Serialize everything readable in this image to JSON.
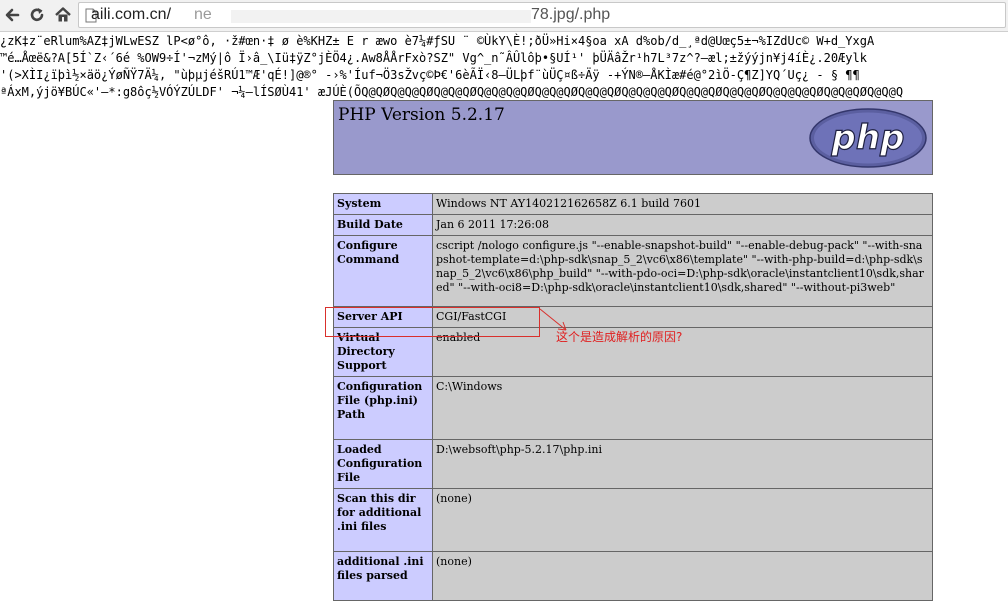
{
  "browser": {
    "back_icon": "back-arrow-icon",
    "reload_icon": "reload-icon",
    "home_icon": "home-icon",
    "url_host": "aili.com.cn/",
    "url_faded": "ne",
    "url_tail": "78.jpg/.php"
  },
  "garbage": [
    "¿zK‡z¨eRlum%AZ‡jWLwESZ lP<ø°ô, ·ž#œn·‡ ø è%KHZ± E r æwo è7¼#ƒSU ¨ ©ÙkY\\È!;ðÜ»Hi×4§oa xA d%ob/d_¸ªd@Uœç5±¬%IZdUc© W+d_YxgA",
    "™é…Åœë&?A[5Í`Z‹´6é %OW9÷Í'¬zMý|ô Ï›â_\\Iü‡ÿZ°jÈÖ4¿.Aw8ÅÅrFxò?SZ\" Vg^_n˜ÂÛlôþ•§UÍ¹' þÜÄâŽr¹h7L³7z^?—æl;±žýýjn¥j4íÈ¿.20Æylk",
    "'(>XÌI¿ïþì½×äö¿ÝøÑŸ7Ä¼, \"ùþµjéšRÚ1™Æ'qÉ!]@®° -›%'Íuf¬Ö3sŽvç©Þ€'6èÃÏ‹8—ÜLþf¨ùÜÇ¤ß÷Äÿ -+ÝN®—ÅKÌæ#é@°2ìÖ-Ç¶Z]YQ´Uç¿ - § ¶¶",
    "ªÁxM,ýjö¥BÚC«'—*:g8ôç½VÓÝZÚLDF' ¬¼—lÍSØÙ41' æJÚÈ(ÕQ@QØQ@Q@QØQ@Q@QØQ@Q@Q@QØQ@Q@QØQ@Q@QØQ@Q@Q@QØQ@Q@QØQ@Q@QØQ@Q@Q@QØQ@Q@QØQ@Q@Q"
  ],
  "php": {
    "title": "PHP Version 5.2.17",
    "logo_text": "php"
  },
  "table": [
    {
      "key": "System",
      "value": "Windows NT AY140212162658Z 6.1 build 7601"
    },
    {
      "key": "Build Date",
      "value": "Jan 6 2011 17:26:08"
    },
    {
      "key": "Configure Command",
      "value": "cscript /nologo configure.js \"--enable-snapshot-build\" \"--enable-debug-pack\" \"--with-snapshot-template=d:\\php-sdk\\snap_5_2\\vc6\\x86\\template\" \"--with-php-build=d:\\php-sdk\\snap_5_2\\vc6\\x86\\php_build\" \"--with-pdo-oci=D:\\php-sdk\\oracle\\instantclient10\\sdk,shared\" \"--with-oci8=D:\\php-sdk\\oracle\\instantclient10\\sdk,shared\" \"--without-pi3web\""
    },
    {
      "key": "Server API",
      "value": "CGI/FastCGI"
    },
    {
      "key": "Virtual Directory Support",
      "value": "enabled"
    },
    {
      "key": "Configuration File (php.ini) Path",
      "value": "C:\\Windows"
    },
    {
      "key": "Loaded Configuration File",
      "value": "D:\\websoft\\php-5.2.17\\php.ini"
    },
    {
      "key": "Scan this dir for additional .ini files",
      "value": "(none)"
    },
    {
      "key": "additional .ini files parsed",
      "value": "(none)"
    }
  ],
  "annotation": {
    "text": "这个是造成解析的原因?",
    "color": "#e02020"
  }
}
